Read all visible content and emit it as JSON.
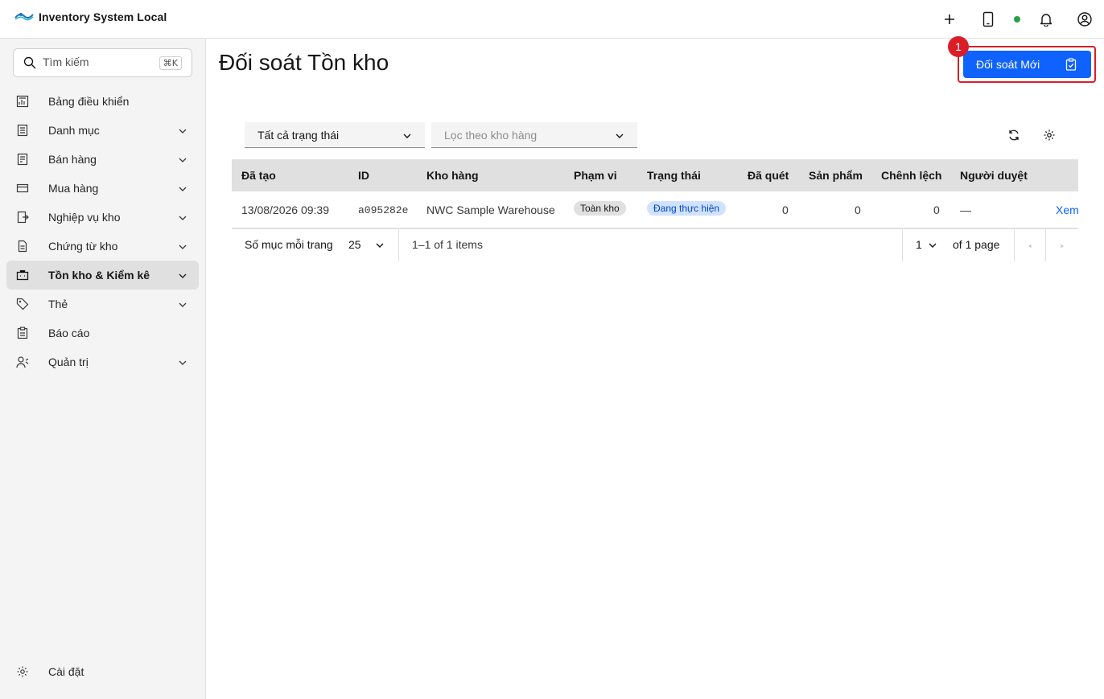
{
  "header": {
    "app_title": "Inventory System Local",
    "icons": [
      "add-icon",
      "tablet-icon",
      "status-dot",
      "notification-icon",
      "user-avatar-icon"
    ],
    "status_color": "#24a148"
  },
  "sidebar": {
    "search": {
      "placeholder": "Tìm kiếm",
      "shortcut": "⌘K"
    },
    "items": [
      {
        "label": "Bảng điều khiển",
        "icon": "dashboard-icon",
        "expandable": false
      },
      {
        "label": "Danh mục",
        "icon": "catalog-icon",
        "expandable": true
      },
      {
        "label": "Bán hàng",
        "icon": "sales-icon",
        "expandable": true
      },
      {
        "label": "Mua hàng",
        "icon": "purchase-icon",
        "expandable": true
      },
      {
        "label": "Nghiệp vụ kho",
        "icon": "warehouse-ops-icon",
        "expandable": true
      },
      {
        "label": "Chứng từ kho",
        "icon": "document-icon",
        "expandable": true
      },
      {
        "label": "Tồn kho & Kiểm kê",
        "icon": "inventory-icon",
        "expandable": true,
        "active": true
      },
      {
        "label": "Thẻ",
        "icon": "tag-icon",
        "expandable": true
      },
      {
        "label": "Báo cáo",
        "icon": "report-icon",
        "expandable": false
      },
      {
        "label": "Quản trị",
        "icon": "admin-icon",
        "expandable": true
      }
    ],
    "settings_label": "Cài đặt"
  },
  "main": {
    "title": "Đối soát Tồn kho",
    "new_button_label": "Đối soát Mới",
    "annotation_badge": "1",
    "filters": {
      "status_value": "Tất cả trạng thái",
      "warehouse_placeholder": "Lọc theo kho hàng"
    },
    "table": {
      "columns": [
        "Đã tạo",
        "ID",
        "Kho hàng",
        "Phạm vi",
        "Trạng thái",
        "Đã quét",
        "Sản phẩm",
        "Chênh lệch",
        "Người duyệt"
      ],
      "rows": [
        {
          "created": "13/08/2026 09:39",
          "id": "a095282e",
          "warehouse": "NWC Sample Warehouse",
          "scope": "Toàn kho",
          "status": "Đang thực hiện",
          "scanned": "0",
          "products": "0",
          "variance": "0",
          "approver": "—",
          "action": "Xem"
        }
      ]
    },
    "pagination": {
      "items_per_page_label": "Số mục mỗi trang",
      "page_size": "25",
      "range_text": "1–1 of 1 items",
      "current_page": "1",
      "total_pages_text": "of 1 page"
    }
  },
  "colors": {
    "primary": "#0f62fe",
    "annotation": "#da1e28",
    "status_tag_bg": "#d0e2ff",
    "status_tag_text": "#0043ce"
  }
}
